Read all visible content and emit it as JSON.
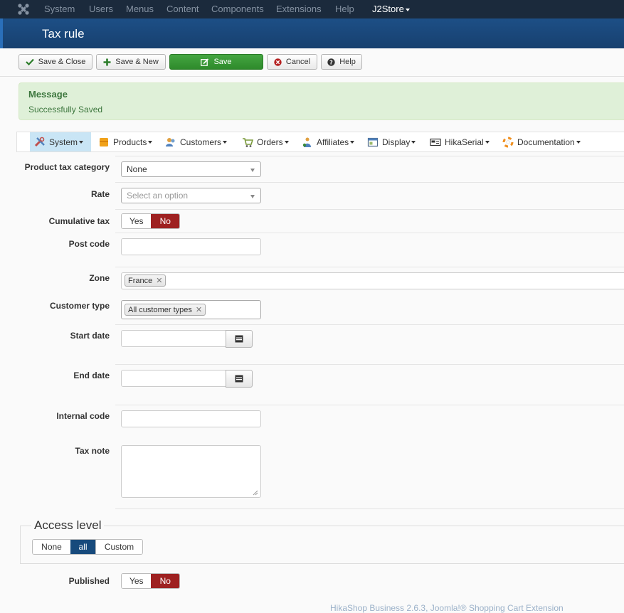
{
  "topnav": {
    "items": [
      "System",
      "Users",
      "Menus",
      "Content",
      "Components",
      "Extensions",
      "Help",
      "J2Store"
    ]
  },
  "page_title": "Tax rule",
  "toolbar": {
    "save_close": "Save & Close",
    "save_new": "Save & New",
    "save": "Save",
    "cancel": "Cancel",
    "help": "Help"
  },
  "message": {
    "heading": "Message",
    "text": "Successfully Saved"
  },
  "hikamenu": {
    "items": [
      "System",
      "Products",
      "Customers",
      "Orders",
      "Affiliates",
      "Display",
      "HikaSerial",
      "Documentation"
    ]
  },
  "form": {
    "product_tax_category": {
      "label": "Product tax category",
      "value": "None"
    },
    "rate": {
      "label": "Rate",
      "placeholder": "Select an option"
    },
    "cumulative_tax": {
      "label": "Cumulative tax",
      "yes": "Yes",
      "no": "No",
      "selected": "No"
    },
    "post_code": {
      "label": "Post code",
      "value": ""
    },
    "zone": {
      "label": "Zone",
      "chips": [
        "France"
      ]
    },
    "customer_type": {
      "label": "Customer type",
      "chips": [
        "All customer types"
      ]
    },
    "start_date": {
      "label": "Start date",
      "value": ""
    },
    "end_date": {
      "label": "End date",
      "value": ""
    },
    "internal_code": {
      "label": "Internal code",
      "value": ""
    },
    "tax_note": {
      "label": "Tax note",
      "value": ""
    },
    "access_level": {
      "legend": "Access level",
      "options": [
        "None",
        "all",
        "Custom"
      ],
      "selected": "all"
    },
    "published": {
      "label": "Published",
      "yes": "Yes",
      "no": "No",
      "selected": "No"
    }
  },
  "footer": "HikaShop Business 2.6.3, Joomla!® Shopping Cart Extension",
  "colors": {
    "navbar": "#1b2a3c",
    "titlebar": "#1d4f86",
    "save_green": "#3a9a37",
    "toggle_no": "#9e2121",
    "access_selected": "#174a7c",
    "message_bg": "#dff0d8"
  }
}
